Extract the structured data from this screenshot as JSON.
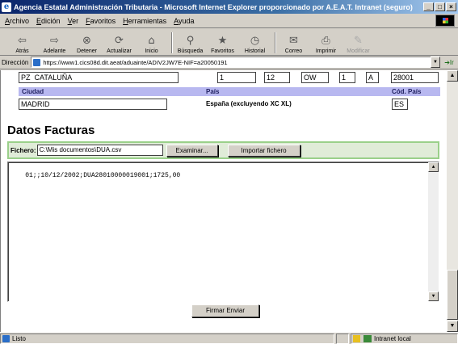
{
  "window": {
    "title": "Agencia Estatal Administración Tributaria - Microsoft Internet Explorer proporcionado por A.E.A.T.  Intranet (seguro)",
    "minimize": "_",
    "maximize": "□",
    "close": "×"
  },
  "menu": [
    "Archivo",
    "Edición",
    "Ver",
    "Favoritos",
    "Herramientas",
    "Ayuda"
  ],
  "toolbar": [
    {
      "label": "Atrás",
      "icon": "back-arrow-icon",
      "glyph": "⇦"
    },
    {
      "label": "Adelante",
      "icon": "forward-arrow-icon",
      "glyph": "⇨"
    },
    {
      "label": "Detener",
      "icon": "stop-icon",
      "glyph": "⊗"
    },
    {
      "label": "Actualizar",
      "icon": "refresh-icon",
      "glyph": "⟳"
    },
    {
      "label": "Inicio",
      "icon": "home-icon",
      "glyph": "⌂"
    },
    {
      "label": "Búsqueda",
      "icon": "search-icon",
      "glyph": "⚲"
    },
    {
      "label": "Favoritos",
      "icon": "favorites-icon",
      "glyph": "★"
    },
    {
      "label": "Historial",
      "icon": "history-icon",
      "glyph": "◷"
    },
    {
      "label": "Correo",
      "icon": "mail-icon",
      "glyph": "✉"
    },
    {
      "label": "Imprimir",
      "icon": "print-icon",
      "glyph": "⎙"
    },
    {
      "label": "Modificar",
      "icon": "edit-icon",
      "glyph": "✎",
      "disabled": true
    }
  ],
  "address": {
    "label": "Dirección",
    "url": "https://www1.cics08d.dit.aeat/aduainte/ADIV2JW7E-NIF=a20050191",
    "go": "Ir"
  },
  "address_form": {
    "via_type": "PZ",
    "street": "CATALUÑA",
    "number": "1",
    "floor": "12",
    "code": "OW",
    "stair": "1",
    "door": "A",
    "postal_code": "28001",
    "labels": {
      "city": "Ciudad",
      "country": "País",
      "country_code": "Cód. País"
    },
    "city": "MADRID",
    "country": "España (excluyendo XC XL)",
    "country_code": "ES"
  },
  "invoices": {
    "title": "Datos Facturas",
    "file_label": "Fichero:",
    "file_value": "C:\\Mis documentos\\DUA.csv",
    "browse_button": "Examinar...",
    "import_button": "Importar fichero",
    "content": "01;;10/12/2002;DUA28010000019001;1725,00",
    "sign_button": "Firmar Enviar"
  },
  "status": {
    "text": "Listo",
    "zone": "Intranet local"
  }
}
